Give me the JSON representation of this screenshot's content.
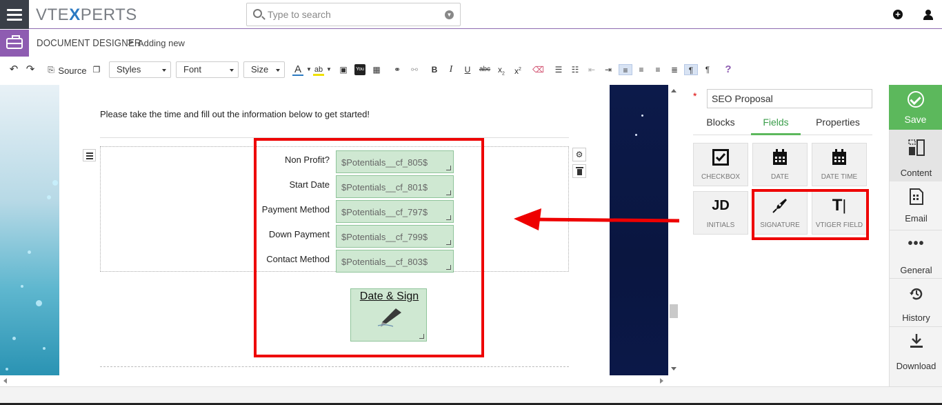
{
  "header": {
    "logo_text_1": "VTE",
    "logo_x": "X",
    "logo_text_2": "PERTS",
    "search_placeholder": "Type to search"
  },
  "breadcrumb": {
    "module": "DOCUMENT DESIGNER",
    "separator": ">",
    "page": "Adding new"
  },
  "toolbar": {
    "source_label": "Source",
    "styles_label": "Styles",
    "font_label": "Font",
    "size_label": "Size",
    "bold": "B",
    "italic": "I",
    "underline": "U",
    "strike": "abc",
    "sub": "x",
    "sup": "x",
    "help": "?"
  },
  "document": {
    "intro_text": "Please take the time and fill out the information below to get started!",
    "fields": [
      {
        "label": "Non Profit?",
        "value": "$Potentials__cf_805$"
      },
      {
        "label": "Start Date",
        "value": "$Potentials__cf_801$"
      },
      {
        "label": "Payment Method",
        "value": "$Potentials__cf_797$"
      },
      {
        "label": "Down Payment",
        "value": "$Potentials__cf_799$"
      },
      {
        "label": "Contact Method",
        "value": "$Potentials__cf_803$"
      }
    ],
    "sign_title": "Date & Sign"
  },
  "panel": {
    "required_mark": "*",
    "template_name": "SEO Proposal",
    "tabs": [
      "Blocks",
      "Fields",
      "Properties"
    ],
    "active_tab": "Fields",
    "tiles": [
      {
        "label": "CHECKBOX",
        "icon": "checkbox-icon"
      },
      {
        "label": "DATE",
        "icon": "calendar-icon"
      },
      {
        "label": "DATE TIME",
        "icon": "calendar-icon"
      },
      {
        "label": "INITIALS",
        "icon": "initials-icon",
        "glyph": "JD"
      },
      {
        "label": "SIGNATURE",
        "icon": "pen-nib-icon"
      },
      {
        "label": "VTIGER FIELD",
        "icon": "text-cursor-icon",
        "glyph": "T"
      }
    ]
  },
  "rail": {
    "save": "Save",
    "content": "Content",
    "email": "Email",
    "general": "General",
    "history": "History",
    "download": "Download"
  },
  "colors": {
    "accent_purple": "#8e5cb1",
    "save_green": "#5cb85c",
    "highlight_red": "#e00000",
    "field_green": "#cfe8d2",
    "logo_blue": "#2b79c2"
  }
}
